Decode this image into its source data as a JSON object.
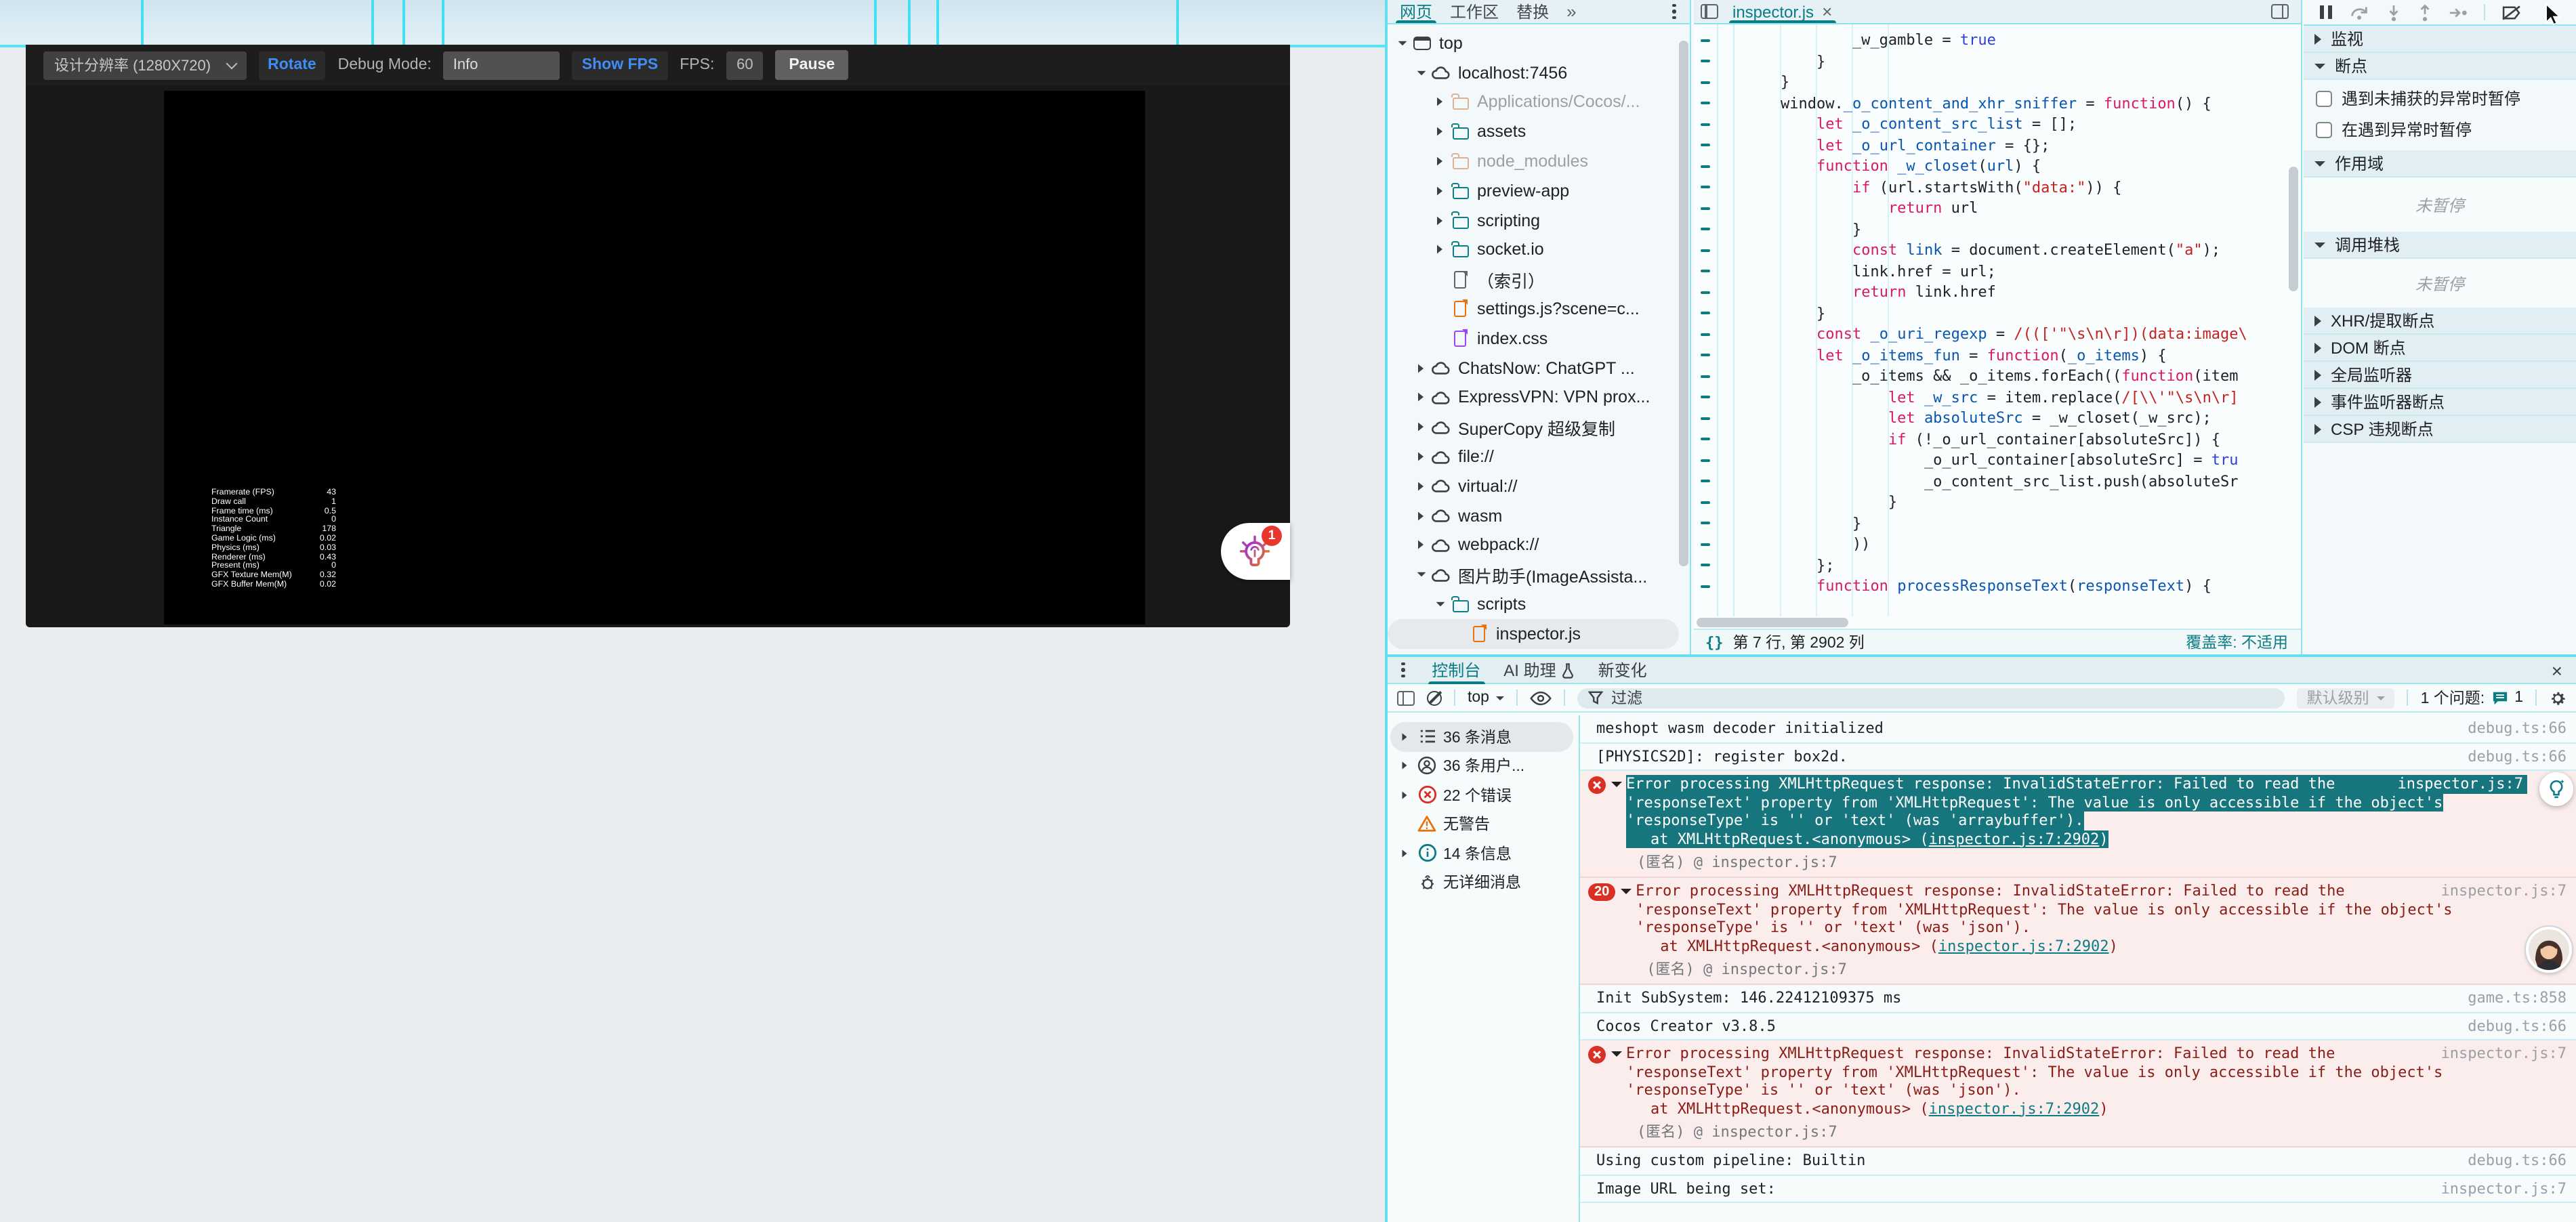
{
  "preview": {
    "resolution_label": "设计分辨率 (1280X720)",
    "rotate": "Rotate",
    "debug_mode_label": "Debug Mode:",
    "debug_mode_value": "Info",
    "show_fps": "Show FPS",
    "fps_label": "FPS:",
    "fps_value": "60",
    "pause": "Pause",
    "assistant_badge": "1",
    "stats": [
      [
        "Framerate (FPS)",
        "43"
      ],
      [
        "Draw call",
        "1"
      ],
      [
        "Frame time (ms)",
        "0.5"
      ],
      [
        "Instance Count",
        "0"
      ],
      [
        "Triangle",
        "178"
      ],
      [
        "Game Logic (ms)",
        "0.02"
      ],
      [
        "Physics (ms)",
        "0.03"
      ],
      [
        "Renderer (ms)",
        "0.43"
      ],
      [
        "Present (ms)",
        "0"
      ],
      [
        "GFX Texture Mem(M)",
        "0.32"
      ],
      [
        "GFX Buffer Mem(M)",
        "0.02"
      ]
    ]
  },
  "sources": {
    "nav_tabs": [
      "网页",
      "工作区",
      "替换"
    ],
    "more_tabs": "»",
    "tree": [
      {
        "label": "top",
        "type": "frame",
        "depth": 0,
        "expanded": true
      },
      {
        "label": "localhost:7456",
        "type": "cloud",
        "depth": 1,
        "expanded": true
      },
      {
        "label": "Applications/Cocos/...",
        "type": "folder-dim",
        "depth": 2,
        "dim": true
      },
      {
        "label": "assets",
        "type": "folder",
        "depth": 2
      },
      {
        "label": "node_modules",
        "type": "folder-dim",
        "depth": 2,
        "dim": true
      },
      {
        "label": "preview-app",
        "type": "folder",
        "depth": 2
      },
      {
        "label": "scripting",
        "type": "folder",
        "depth": 2
      },
      {
        "label": "socket.io",
        "type": "folder",
        "depth": 2
      },
      {
        "label": "（索引）",
        "type": "file-doc",
        "depth": 2,
        "leaf": true
      },
      {
        "label": "settings.js?scene=c...",
        "type": "file-js",
        "depth": 2,
        "leaf": true
      },
      {
        "label": "index.css",
        "type": "file-css",
        "depth": 2,
        "leaf": true
      },
      {
        "label": "ChatsNow: ChatGPT ...",
        "type": "cloud",
        "depth": 1
      },
      {
        "label": "ExpressVPN: VPN prox...",
        "type": "cloud",
        "depth": 1
      },
      {
        "label": "SuperCopy 超级复制",
        "type": "cloud",
        "depth": 1
      },
      {
        "label": "file://",
        "type": "cloud",
        "depth": 1
      },
      {
        "label": "virtual://",
        "type": "cloud",
        "depth": 1
      },
      {
        "label": "wasm",
        "type": "cloud",
        "depth": 1
      },
      {
        "label": "webpack://",
        "type": "cloud",
        "depth": 1
      },
      {
        "label": "图片助手(ImageAssista...",
        "type": "cloud",
        "depth": 1,
        "expanded": true
      },
      {
        "label": "scripts",
        "type": "folder",
        "depth": 2,
        "expanded": true
      },
      {
        "label": "inspector.js",
        "type": "file-js",
        "depth": 3,
        "leaf": true,
        "selected": true
      }
    ],
    "editor_tab": "inspector.js",
    "status_line_col": "第 7 行, 第 2902 列",
    "status_coverage": "覆盖率: 不适用",
    "code": [
      [
        [
          "p",
          "            _w_gamble = "
        ],
        [
          "b",
          "true"
        ]
      ],
      [
        [
          "p",
          "        }"
        ]
      ],
      [
        [
          "p",
          "    }"
        ]
      ],
      [
        [
          "p",
          "    window."
        ],
        [
          "v",
          "_o_content_and_xhr_sniffer"
        ],
        [
          "p",
          " = "
        ],
        [
          "k",
          "function"
        ],
        [
          "p",
          "() {"
        ]
      ],
      [
        [
          "p",
          "        "
        ],
        [
          "k",
          "let"
        ],
        [
          "p",
          " "
        ],
        [
          "v",
          "_o_content_src_list"
        ],
        [
          "p",
          " = [];"
        ]
      ],
      [
        [
          "p",
          "        "
        ],
        [
          "k",
          "let"
        ],
        [
          "p",
          " "
        ],
        [
          "v",
          "_o_url_container"
        ],
        [
          "p",
          " = {};"
        ]
      ],
      [
        [
          "p",
          "        "
        ],
        [
          "k",
          "function"
        ],
        [
          "p",
          " "
        ],
        [
          "v",
          "_w_closet"
        ],
        [
          "p",
          "("
        ],
        [
          "v",
          "url"
        ],
        [
          "p",
          ") {"
        ]
      ],
      [
        [
          "p",
          "            "
        ],
        [
          "k",
          "if"
        ],
        [
          "p",
          " (url.startsWith("
        ],
        [
          "s",
          "\"data:\""
        ],
        [
          "p",
          ")) {"
        ]
      ],
      [
        [
          "p",
          "                "
        ],
        [
          "k",
          "return"
        ],
        [
          "p",
          " url"
        ]
      ],
      [
        [
          "p",
          "            }"
        ]
      ],
      [
        [
          "p",
          "            "
        ],
        [
          "k",
          "const"
        ],
        [
          "p",
          " "
        ],
        [
          "v",
          "link"
        ],
        [
          "p",
          " = document.createElement("
        ],
        [
          "s",
          "\"a\""
        ],
        [
          "p",
          ");"
        ]
      ],
      [
        [
          "p",
          "            link.href = url;"
        ]
      ],
      [
        [
          "p",
          "            "
        ],
        [
          "k",
          "return"
        ],
        [
          "p",
          " link.href"
        ]
      ],
      [
        [
          "p",
          "        }"
        ]
      ],
      [
        [
          "p",
          "        "
        ],
        [
          "k",
          "const"
        ],
        [
          "p",
          " "
        ],
        [
          "v",
          "_o_uri_regexp"
        ],
        [
          "p",
          " = "
        ],
        [
          "s",
          "/((['\"\\s\\n\\r])(data:image\\"
        ]
      ],
      [
        [
          "p",
          "        "
        ],
        [
          "k",
          "let"
        ],
        [
          "p",
          " "
        ],
        [
          "v",
          "_o_items_fun"
        ],
        [
          "p",
          " = "
        ],
        [
          "k",
          "function"
        ],
        [
          "p",
          "("
        ],
        [
          "v",
          "_o_items"
        ],
        [
          "p",
          ") {"
        ]
      ],
      [
        [
          "p",
          "            _o_items && _o_items.forEach(("
        ],
        [
          "k",
          "function"
        ],
        [
          "p",
          "(item"
        ]
      ],
      [
        [
          "p",
          "                "
        ],
        [
          "k",
          "let"
        ],
        [
          "p",
          " "
        ],
        [
          "v",
          "_w_src"
        ],
        [
          "p",
          " = item.replace("
        ],
        [
          "s",
          "/[\\\\'\"\\s\\n\\r]"
        ]
      ],
      [
        [
          "p",
          "                "
        ],
        [
          "k",
          "let"
        ],
        [
          "p",
          " "
        ],
        [
          "v",
          "absoluteSrc"
        ],
        [
          "p",
          " = _w_closet(_w_src);"
        ]
      ],
      [
        [
          "p",
          "                "
        ],
        [
          "k",
          "if"
        ],
        [
          "p",
          " (!_o_url_container[absoluteSrc]) {"
        ]
      ],
      [
        [
          "p",
          "                    _o_url_container[absoluteSrc] = "
        ],
        [
          "b",
          "tru"
        ]
      ],
      [
        [
          "p",
          "                    _o_content_src_list.push(absoluteSr"
        ]
      ],
      [
        [
          "p",
          "                }"
        ]
      ],
      [
        [
          "p",
          "            }"
        ]
      ],
      [
        [
          "p",
          "            ))"
        ]
      ],
      [
        [
          "p",
          "        };"
        ]
      ],
      [
        [
          "p",
          "        "
        ],
        [
          "k",
          "function"
        ],
        [
          "p",
          " "
        ],
        [
          "v",
          "processResponseText"
        ],
        [
          "p",
          "("
        ],
        [
          "v",
          "responseText"
        ],
        [
          "p",
          ") {"
        ]
      ]
    ]
  },
  "debugger": {
    "watch": "监视",
    "breakpoints": "断点",
    "pause_checkboxes": [
      "遇到未捕获的异常时暂停",
      "在遇到异常时暂停"
    ],
    "scope": "作用域",
    "call_stack": "调用堆栈",
    "not_paused": "未暂停",
    "sections": [
      "XHR/提取断点",
      "DOM 断点",
      "全局监听器",
      "事件监听器断点",
      "CSP 违规断点"
    ]
  },
  "console": {
    "tabs": [
      "控制台",
      "AI 助理",
      "新变化"
    ],
    "context": "top",
    "filter": "过滤",
    "level": "默认级别",
    "issues": "1 个问题:",
    "issues_count": "1",
    "sidebar": [
      {
        "icon": "list",
        "label": "36 条消息",
        "selected": true,
        "expandable": true
      },
      {
        "icon": "user",
        "label": "36 条用户...",
        "expandable": true
      },
      {
        "icon": "error",
        "label": "22 个错误",
        "expandable": true
      },
      {
        "icon": "warning",
        "label": "无警告"
      },
      {
        "icon": "info",
        "label": "14 条信息",
        "expandable": true
      },
      {
        "icon": "bug",
        "label": "无详细消息"
      }
    ],
    "messages": [
      {
        "type": "log",
        "text": "meshopt wasm decoder initialized",
        "source": "debug.ts:66"
      },
      {
        "type": "log",
        "text": "[PHYSICS2D]: register box2d.",
        "source": "debug.ts:66"
      },
      {
        "type": "error",
        "selected": true,
        "bulb": true,
        "source": "inspector.js:7",
        "lines": [
          "Error processing XMLHttpRequest response: InvalidStateError: Failed to read the",
          "'responseText' property from 'XMLHttpRequest': The value is only accessible if the object's",
          "'responseType' is '' or 'text' (was 'arraybuffer')."
        ],
        "stack_pre": "at XMLHttpRequest.<anonymous> (",
        "stack_link": "inspector.js:7:2902",
        "stack_post": ")",
        "frame": "(匿名) @ inspector.js:7"
      },
      {
        "type": "error",
        "badge": "20",
        "avatar": true,
        "source": "inspector.js:7",
        "lines": [
          "Error processing XMLHttpRequest response: InvalidStateError: Failed to read the",
          "'responseText' property from 'XMLHttpRequest': The value is only accessible if the object's",
          "'responseType' is '' or 'text' (was 'json')."
        ],
        "stack_pre": "at XMLHttpRequest.<anonymous> (",
        "stack_link": "inspector.js:7:2902",
        "stack_post": ")",
        "frame": "(匿名) @ inspector.js:7"
      },
      {
        "type": "log",
        "text": "Init SubSystem: 146.22412109375 ms",
        "source": "game.ts:858"
      },
      {
        "type": "log",
        "text": "Cocos Creator v3.8.5",
        "source": "debug.ts:66"
      },
      {
        "type": "error",
        "source": "inspector.js:7",
        "lines": [
          "Error processing XMLHttpRequest response: InvalidStateError: Failed to read the",
          "'responseText' property from 'XMLHttpRequest': The value is only accessible if the object's",
          "'responseType' is '' or 'text' (was 'json')."
        ],
        "stack_pre": "at XMLHttpRequest.<anonymous> (",
        "stack_link": "inspector.js:7:2902",
        "stack_post": ")",
        "frame": "(匿名) @ inspector.js:7"
      },
      {
        "type": "log",
        "text": "Using custom pipeline: Builtin",
        "source": "debug.ts:66"
      },
      {
        "type": "log",
        "text": "Image URL being set:",
        "source": "inspector.js:7"
      }
    ]
  }
}
